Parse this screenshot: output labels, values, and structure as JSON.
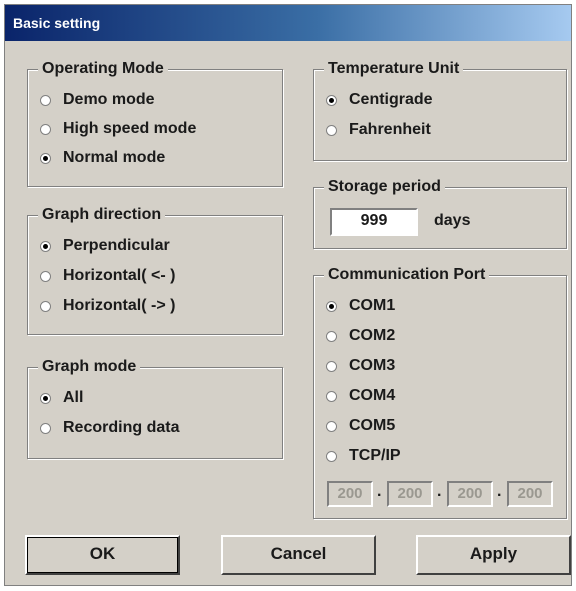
{
  "window": {
    "title": "Basic setting"
  },
  "operating_mode": {
    "legend": "Operating Mode",
    "options": [
      {
        "label": "Demo mode",
        "selected": false
      },
      {
        "label": "High speed mode",
        "selected": false
      },
      {
        "label": "Normal mode",
        "selected": true
      }
    ]
  },
  "graph_direction": {
    "legend": "Graph direction",
    "options": [
      {
        "label": "Perpendicular",
        "selected": true
      },
      {
        "label": "Horizontal( <- )",
        "selected": false
      },
      {
        "label": "Horizontal( -> )",
        "selected": false
      }
    ]
  },
  "graph_mode": {
    "legend": "Graph mode",
    "options": [
      {
        "label": "All",
        "selected": true
      },
      {
        "label": "Recording data",
        "selected": false
      }
    ]
  },
  "temperature_unit": {
    "legend": "Temperature Unit",
    "options": [
      {
        "label": "Centigrade",
        "selected": true
      },
      {
        "label": "Fahrenheit",
        "selected": false
      }
    ]
  },
  "storage_period": {
    "legend": "Storage period",
    "value": "999",
    "unit": "days"
  },
  "communication_port": {
    "legend": "Communication Port",
    "options": [
      {
        "label": "COM1",
        "selected": true
      },
      {
        "label": "COM2",
        "selected": false
      },
      {
        "label": "COM3",
        "selected": false
      },
      {
        "label": "COM4",
        "selected": false
      },
      {
        "label": "COM5",
        "selected": false
      },
      {
        "label": "TCP/IP",
        "selected": false
      }
    ],
    "ip_octets": [
      "200",
      "200",
      "200",
      "200"
    ],
    "ip_separator": "."
  },
  "buttons": {
    "ok": "OK",
    "cancel": "Cancel",
    "apply": "Apply"
  }
}
